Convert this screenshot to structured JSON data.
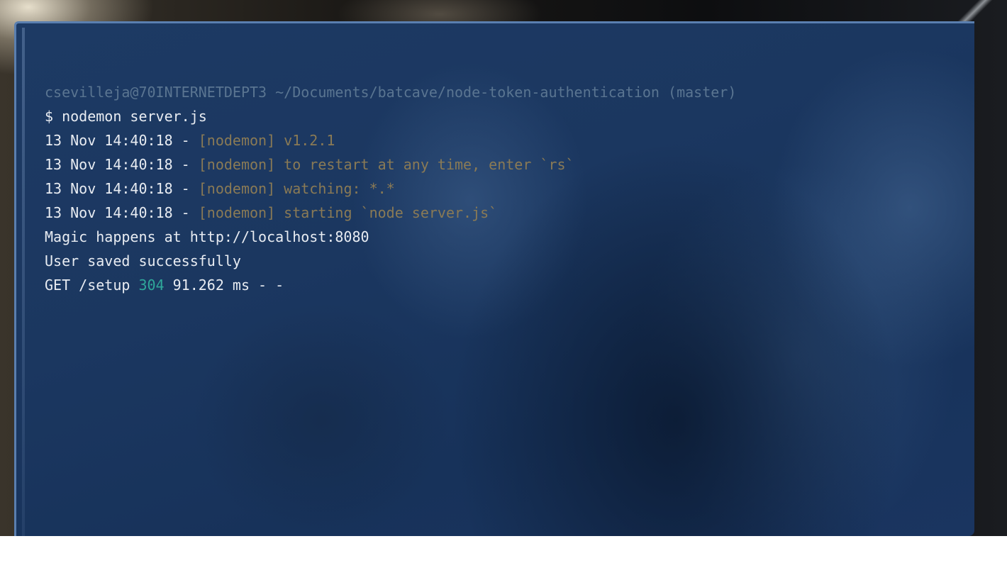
{
  "prompt": {
    "user_host": "csevilleja@70INTERNETDEPT3",
    "path": "~/Documents/batcave/node-token-authentication",
    "branch": "(master)"
  },
  "command": "$ nodemon server.js",
  "log_lines": [
    {
      "timestamp": "13 Nov 14:40:18 - ",
      "tag": "[nodemon]",
      "message": " v1.2.1"
    },
    {
      "timestamp": "13 Nov 14:40:18 - ",
      "tag": "[nodemon]",
      "message": " to restart at any time, enter `rs`"
    },
    {
      "timestamp": "13 Nov 14:40:18 - ",
      "tag": "[nodemon]",
      "message": " watching: *.*"
    },
    {
      "timestamp": "13 Nov 14:40:18 - ",
      "tag": "[nodemon]",
      "message": " starting `node server.js`"
    }
  ],
  "output": {
    "magic": "Magic happens at http://localhost:8080",
    "user_saved": "User saved successfully",
    "request_method_path": "GET /setup ",
    "request_status": "304",
    "request_timing": " 91.262 ms - -"
  },
  "colors": {
    "terminal_background": "#1b3760",
    "text_default": "#e8ecf2",
    "prompt_dim": "#5a7591",
    "nodemon_tag": "#8a7a55",
    "status_code": "#2fa89a",
    "window_border": "#5a7fb0"
  }
}
